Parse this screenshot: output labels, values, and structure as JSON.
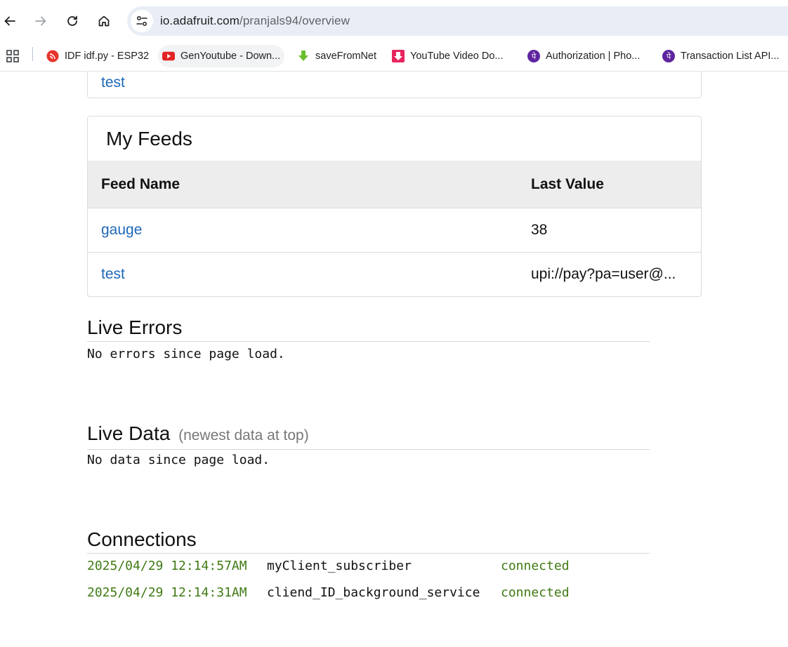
{
  "browser": {
    "url_host": "io.adafruit.com",
    "url_path": "/pranjals94/overview",
    "bookmarks": [
      {
        "label": "IDF idf.py - ESP32",
        "icon": "espressif-icon"
      },
      {
        "label": "GenYoutube - Down...",
        "icon": "youtube-icon"
      },
      {
        "label": "saveFromNet",
        "icon": "download-arrow-icon"
      },
      {
        "label": "YouTube Video Do...",
        "icon": "video-download-icon"
      },
      {
        "label": "Authorization | Pho...",
        "icon": "phonepe-icon"
      },
      {
        "label": "Transaction List API...",
        "icon": "phonepe-icon"
      }
    ]
  },
  "top_panel": {
    "link": "test"
  },
  "feeds": {
    "title": "My Feeds",
    "columns": [
      "Feed Name",
      "Last Value"
    ],
    "rows": [
      {
        "name": "gauge",
        "value": "38"
      },
      {
        "name": "test",
        "value": "upi://pay?pa=user@..."
      }
    ]
  },
  "live_errors": {
    "title": "Live Errors",
    "message": "No errors since page load."
  },
  "live_data": {
    "title": "Live Data",
    "subtitle": "(newest data at top)",
    "message": "No data since page load."
  },
  "connections": {
    "title": "Connections",
    "rows": [
      {
        "time": "2025/04/29 12:14:57AM",
        "client": "myClient_subscriber",
        "status": "connected"
      },
      {
        "time": "2025/04/29 12:14:31AM",
        "client": "cliend_ID_background_service",
        "status": "connected"
      }
    ]
  },
  "colors": {
    "link": "#1e68b8",
    "connected": "#3f7a13",
    "table_header_bg": "#ededed",
    "omnibox_bg": "#e9eef6"
  }
}
